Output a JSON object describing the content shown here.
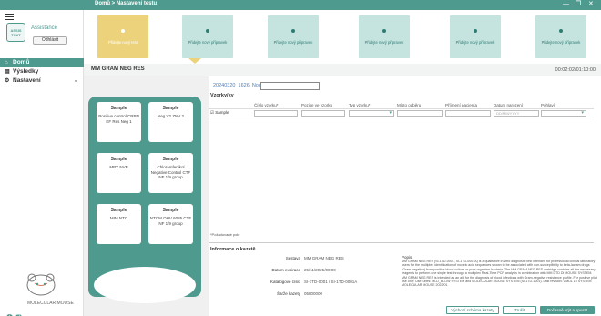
{
  "breadcrumb": "Domů > Nastavení testu",
  "window_controls": [
    "—",
    "❐",
    "✕"
  ],
  "sidebar": {
    "assistant_logo_text": "ASSIS TANT",
    "assistant_label": "Assistance",
    "logout_label": "Odhlásit",
    "items": [
      {
        "label": "Domů",
        "icon": "home-icon"
      },
      {
        "label": "Výsledky",
        "icon": "results-icon"
      },
      {
        "label": "Nastavení",
        "icon": "gear-icon"
      }
    ],
    "logo_text": "MOLECULAR MOUSE",
    "help_icons": [
      "info-icon",
      "help-icon"
    ]
  },
  "stepper": {
    "steps": [
      {
        "label": "Přidejte nový test",
        "active": true
      },
      {
        "label": "Přidejte nový přípravek",
        "active": false
      },
      {
        "label": "Přidejte nový přípravek",
        "active": false
      },
      {
        "label": "Přidejte nový přípravek",
        "active": false
      },
      {
        "label": "Přidejte nový přípravek",
        "active": false
      },
      {
        "label": "Přidejte nový přípravek",
        "active": false
      }
    ]
  },
  "header": {
    "kit_name": "MM GRAM NEG RES",
    "time": "00:02:02/01:10:00"
  },
  "run_name": {
    "label": "20240320_1626_NogRes_",
    "value": ""
  },
  "samples": {
    "title": "Vzorky/ky",
    "columns": [
      "Číslo vzorku*",
      "Pozice ve vzorku",
      "Typ vzorku*",
      "Místo odběru",
      "Příjmení pacienta",
      "Datum narození",
      "Pohlaví"
    ],
    "row": {
      "id": "Sample",
      "date_placeholder": "DD/MM/YYYY"
    },
    "required_note": "*Požadované pole"
  },
  "plate": {
    "wells": [
      {
        "title": "Sample",
        "detail": "Positive control CRPN EF Res Neg 1"
      },
      {
        "title": "Sample",
        "detail": "Neg V2 ZNV 2"
      },
      {
        "title": "Sample",
        "detail": "MPY NVP"
      },
      {
        "title": "Sample",
        "detail": "Chloramfenikol Negative Control CTF NF 1/9 group"
      },
      {
        "title": "Sample",
        "detail": "MIM NTC"
      },
      {
        "title": "Sample",
        "detail": "NTCM OHV 6085 CTF NF 1/9 group"
      }
    ]
  },
  "info": {
    "title": "Informace o kazetě",
    "fields": [
      {
        "key": "Sestava",
        "value": "MM GRAM NEG RES"
      },
      {
        "key": "Datum expirace",
        "value": "25/11/2025/00:00"
      },
      {
        "key": "Katalogové číslo",
        "value": "SI-1TD-0001 / SI-1TD-0001A"
      },
      {
        "key": "Šarže kazety",
        "value": "05800000"
      }
    ],
    "popis_label": "Popis",
    "popis": "MM GRAM NEG RES (SI-1TD-0001, SI-1TD-0001A) is a qualitative in vitro diagnostic test intended for professional clinical laboratory users for the multiplex identification of nucleic acid sequences shown to be associated with non-susceptibility to beta-lactam drugs (Gram-negative) from positive blood culture or pure organism bacteria. The MM GRAM NEG RES cartridge contains all the necessary reagents to perform one single test through a multiplex Real-Time PCR analysis in combination with MM DTD DI MOUSE SYSTEM. MM GRAM NEG RES is intended as an aid for the diagnosis of blood infections with Gram-negative resistance profile. For positive pilot use only. Use tubes: MLD_BLOW SYSTEM and MOLECULAR MOUSE SYSTEM (SI-1TD-1001). Last revision: UMDL 10 SYSTEM MOLECULAR MOUSE 2022/01"
  },
  "buttons": {
    "default_cassette": "Výchozí schéma kazety",
    "cancel": "Zrušit",
    "save_run": "Dočasně vrýt a spustit"
  },
  "colors": {
    "primary": "#4f9a8f",
    "active_step": "#ecd27a",
    "step": "#c5e3df"
  }
}
